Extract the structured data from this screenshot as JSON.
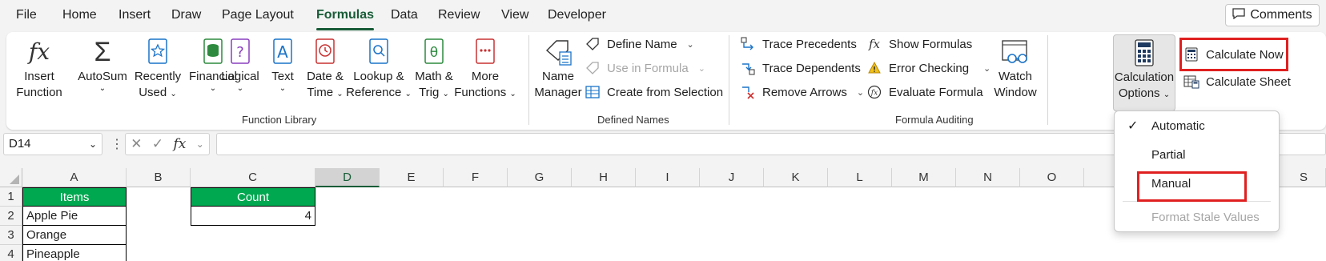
{
  "menu_tabs": [
    "File",
    "Home",
    "Insert",
    "Draw",
    "Page Layout",
    "Formulas",
    "Data",
    "Review",
    "View",
    "Developer"
  ],
  "active_tab": "Formulas",
  "comments_label": "Comments",
  "function_library": {
    "insert_function": [
      "Insert",
      "Function"
    ],
    "autosum": "AutoSum",
    "recently_used": [
      "Recently",
      "Used"
    ],
    "financial": "Financial",
    "logical": "Logical",
    "text": "Text",
    "date_time": [
      "Date &",
      "Time"
    ],
    "lookup": [
      "Lookup &",
      "Reference"
    ],
    "math": [
      "Math &",
      "Trig"
    ],
    "more": [
      "More",
      "Functions"
    ],
    "group_label": "Function Library"
  },
  "defined_names": {
    "name_manager": [
      "Name",
      "Manager"
    ],
    "define_name": "Define Name",
    "use_in_formula": "Use in Formula",
    "create_from_selection": "Create from Selection",
    "group_label": "Defined Names"
  },
  "formula_auditing": {
    "trace_precedents": "Trace Precedents",
    "trace_dependents": "Trace Dependents",
    "remove_arrows": "Remove Arrows",
    "show_formulas": "Show Formulas",
    "error_checking": "Error Checking",
    "evaluate_formula": "Evaluate Formula",
    "watch_window": [
      "Watch",
      "Window"
    ],
    "group_label": "Formula Auditing"
  },
  "calculation": {
    "options": [
      "Calculation",
      "Options"
    ],
    "calculate_now": "Calculate Now",
    "calculate_sheet": "Calculate Sheet"
  },
  "calc_menu": {
    "automatic": "Automatic",
    "partial": "Partial",
    "manual": "Manual",
    "format_stale": "Format Stale Values"
  },
  "name_box": "D14",
  "fx_symbol": "fx",
  "columns": [
    "A",
    "B",
    "C",
    "D",
    "E",
    "F",
    "G",
    "H",
    "I",
    "J",
    "K",
    "L",
    "M",
    "N",
    "O",
    "S"
  ],
  "rows": [
    "1",
    "2",
    "3",
    "4"
  ],
  "cells": {
    "A1": "Items",
    "A2": "Apple Pie",
    "A3": "Orange",
    "A4": "Pineapple",
    "C1": "Count",
    "C2": "4"
  },
  "colors": {
    "accent": "#185c37",
    "header_fill": "#00a850",
    "highlight": "#e02020"
  }
}
